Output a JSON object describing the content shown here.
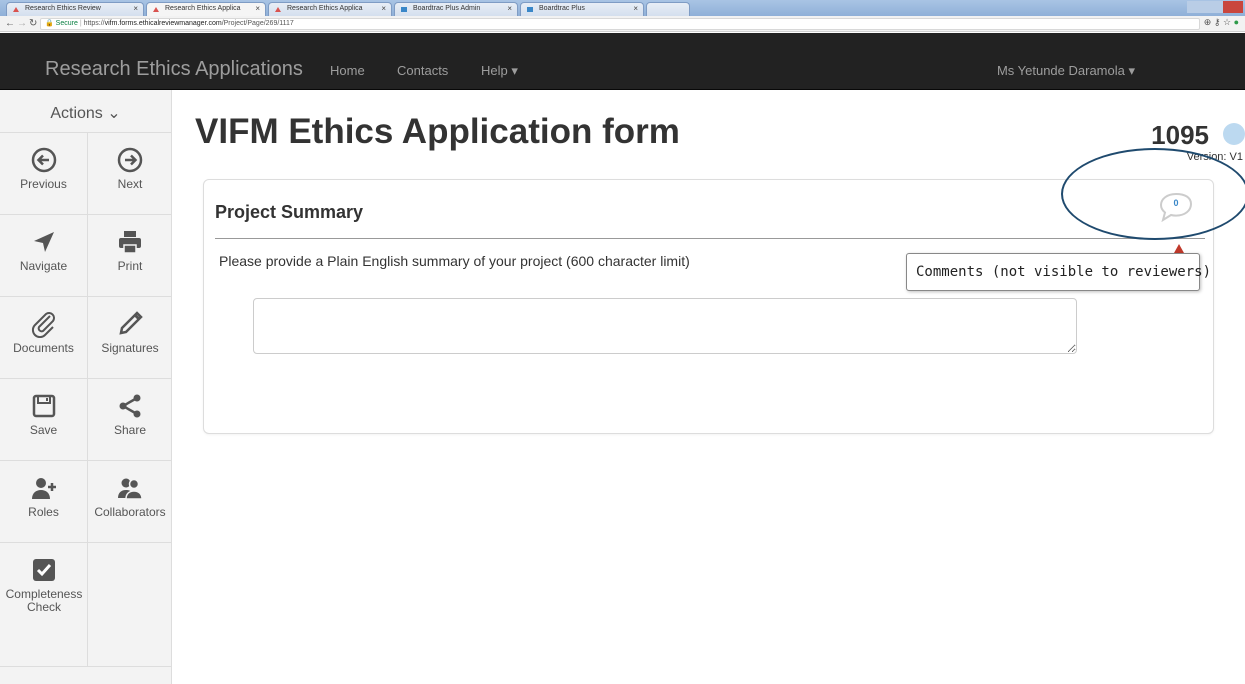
{
  "browser": {
    "tabs": [
      {
        "label": "Research Ethics Review",
        "active": false
      },
      {
        "label": "Research Ethics Applica",
        "active": true
      },
      {
        "label": "Research Ethics Applica",
        "active": false
      },
      {
        "label": "Boardtrac Plus Admin",
        "active": false
      },
      {
        "label": "Boardtrac Plus",
        "active": false
      }
    ],
    "secure_label": "Secure",
    "url_scheme": "https://",
    "url_host": "vifm.forms.ethicalreviewmanager.com",
    "url_path": "/Project/Page/269/1117"
  },
  "navbar": {
    "brand": "Research Ethics Applications",
    "links": [
      "Home",
      "Contacts",
      "Help ▾"
    ],
    "user": "Ms Yetunde Daramola ▾"
  },
  "sidebar": {
    "header": "Actions ⌄",
    "items": [
      {
        "label": "Previous",
        "icon": "arrow-left-circle-icon"
      },
      {
        "label": "Next",
        "icon": "arrow-right-circle-icon"
      },
      {
        "label": "Navigate",
        "icon": "location-arrow-icon"
      },
      {
        "label": "Print",
        "icon": "printer-icon"
      },
      {
        "label": "Documents",
        "icon": "paperclip-icon"
      },
      {
        "label": "Signatures",
        "icon": "pen-icon"
      },
      {
        "label": "Save",
        "icon": "floppy-disk-icon"
      },
      {
        "label": "Share",
        "icon": "share-icon"
      },
      {
        "label": "Roles",
        "icon": "add-user-icon"
      },
      {
        "label": "Collaborators",
        "icon": "users-icon"
      },
      {
        "label": "Completeness Check",
        "icon": "checkbox-icon"
      }
    ]
  },
  "main": {
    "title": "VIFM Ethics Application form",
    "project_number": "1095",
    "version": "Version: V1",
    "panel": {
      "title": "Project Summary",
      "question": "Please provide a Plain English summary of your project (600 character limit)",
      "answer_value": "",
      "comment_count": "0",
      "comment_tooltip": "Comments (not visible to reviewers)"
    }
  },
  "colors": {
    "navbar_bg": "#222222",
    "navbar_text": "#9d9d9d",
    "sidebar_bg": "#f3f3f3",
    "comment_accent": "#3a87c8",
    "annotation_ellipse": "#1f4a6e",
    "checkbox_bg": "#555555"
  }
}
